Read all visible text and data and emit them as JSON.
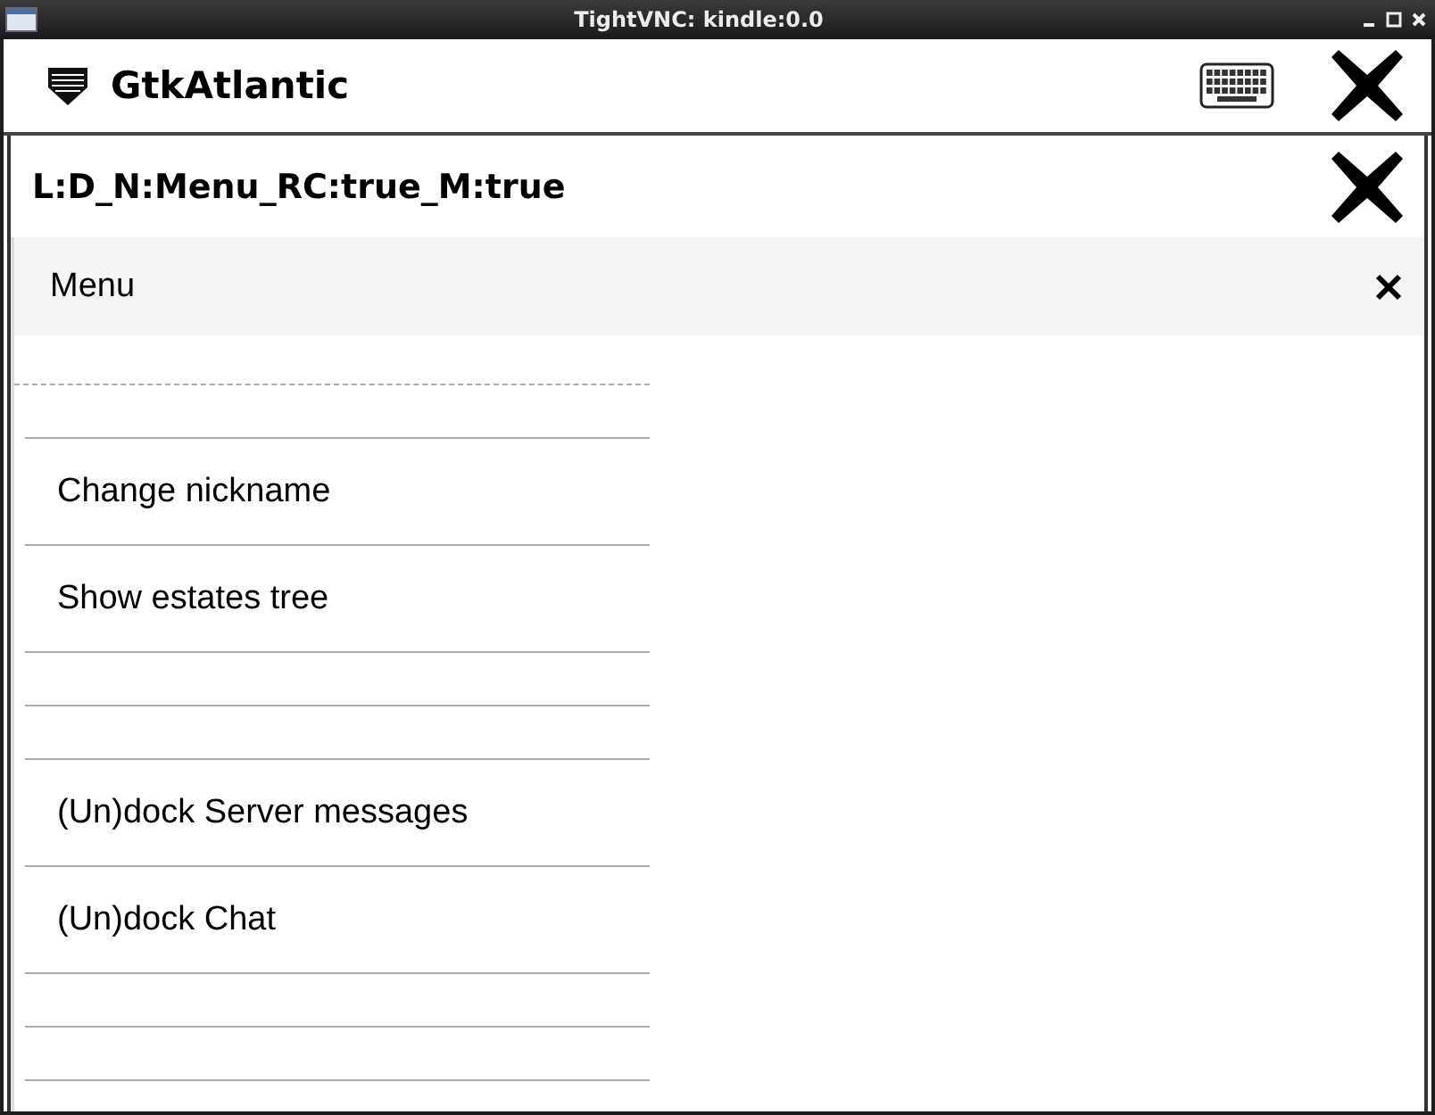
{
  "window": {
    "title": "TightVNC: kindle:0.0"
  },
  "app_bar": {
    "title": "GtkAtlantic"
  },
  "dialog_bar": {
    "title": "L:D_N:Menu_RC:true_M:true"
  },
  "menu_header": {
    "title": "Menu"
  },
  "menu_items": [
    {
      "kind": "tearoff"
    },
    {
      "kind": "spacer"
    },
    {
      "kind": "item",
      "label": "Change nickname"
    },
    {
      "kind": "item",
      "label": "Show estates tree"
    },
    {
      "kind": "spacer"
    },
    {
      "kind": "spacer"
    },
    {
      "kind": "item",
      "label": "(Un)dock Server messages"
    },
    {
      "kind": "item",
      "label": "(Un)dock Chat"
    },
    {
      "kind": "spacer"
    },
    {
      "kind": "spacer"
    }
  ]
}
